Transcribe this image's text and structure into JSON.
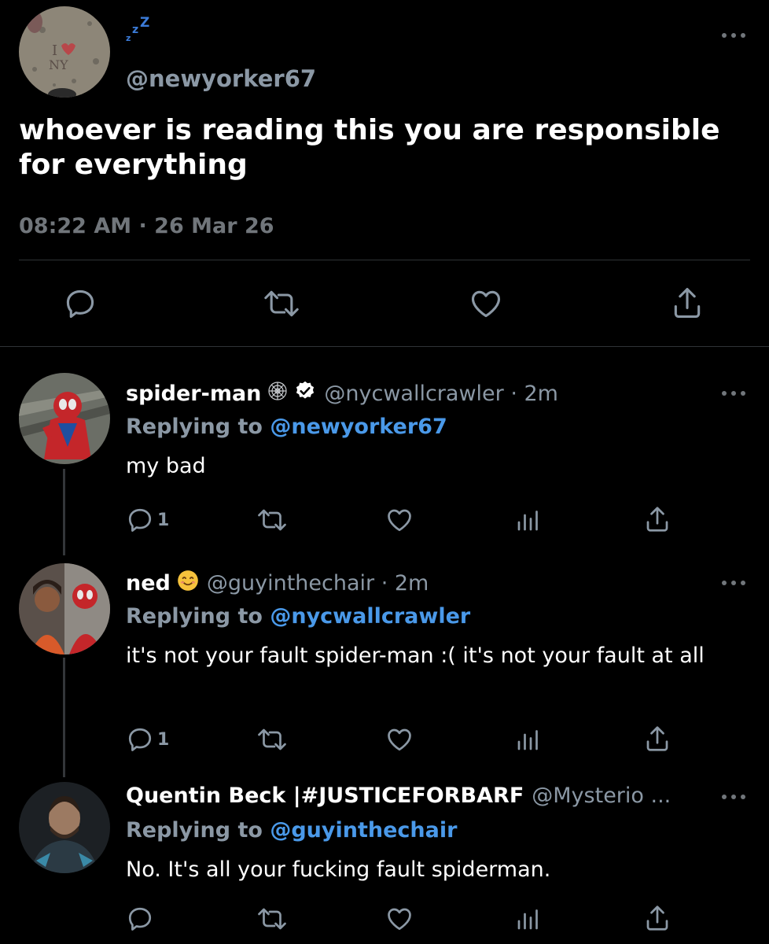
{
  "main": {
    "status_emoji": "zZZ",
    "handle": "@newyorker67",
    "text": "whoever is reading this you are responsible for everything",
    "timestamp": "08:22 AM · 26 Mar 26"
  },
  "replies": [
    {
      "name": "spider-man",
      "handle": "@nycwallcrawler · 2m",
      "replying_prefix": "Replying to ",
      "replying_to": "@newyorker67",
      "text": "my bad",
      "reply_count": "1"
    },
    {
      "name": "ned",
      "handle": "@guyinthechair · 2m",
      "replying_prefix": "Replying to ",
      "replying_to": "@nycwallcrawler",
      "text": "it's not your fault spider-man :( it's not your fault at all",
      "reply_count": "1"
    },
    {
      "name": "Quentin Beck |#JUSTICEFORBARF",
      "handle": "@Mysterio ...",
      "replying_prefix": "Replying to ",
      "replying_to": "@guyinthechair",
      "text": "No. It's all your fucking fault spiderman.",
      "reply_count": ""
    }
  ],
  "colors": {
    "background": "#000000",
    "text": "#e7e9ea",
    "secondary": "#71767b",
    "mention": "#4a99e9",
    "divider": "#2f3336"
  },
  "icons": [
    "reply-icon",
    "retweet-icon",
    "like-icon",
    "share-icon",
    "views-icon",
    "more-icon",
    "verified-icon",
    "web-icon",
    "smile-emoji"
  ]
}
